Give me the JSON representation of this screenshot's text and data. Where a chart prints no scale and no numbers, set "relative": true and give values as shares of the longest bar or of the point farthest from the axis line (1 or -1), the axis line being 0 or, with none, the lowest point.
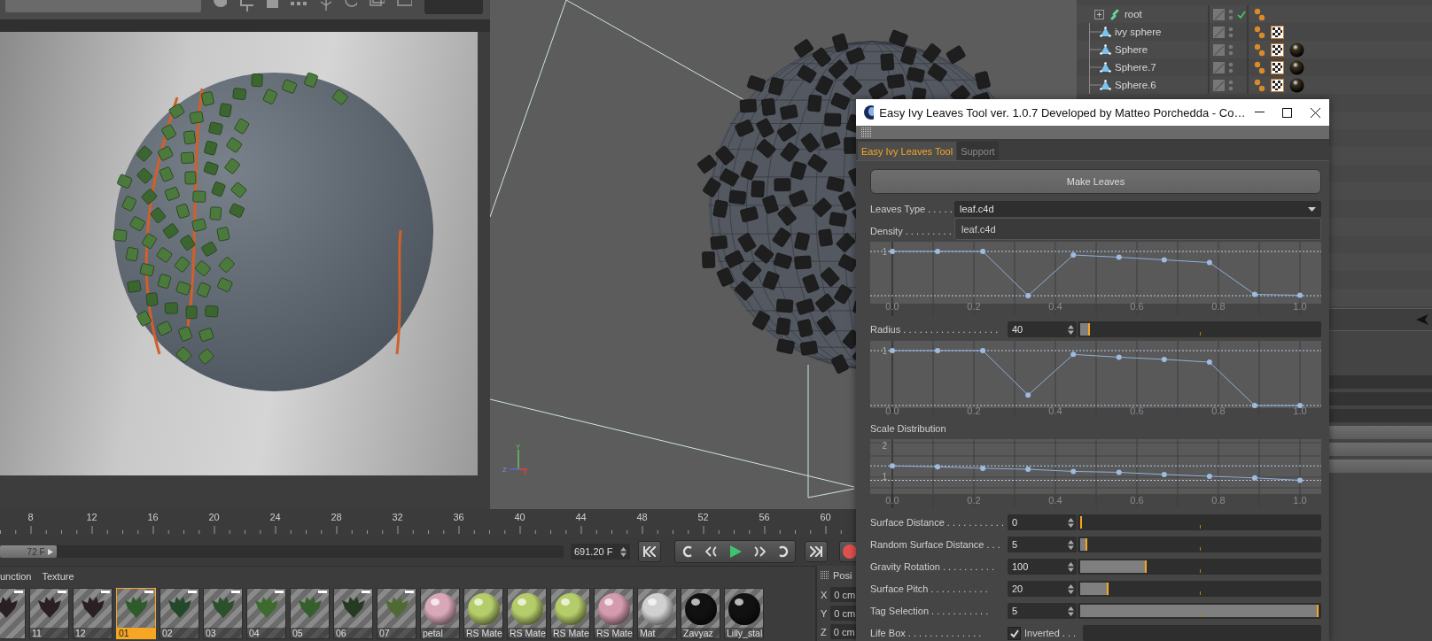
{
  "viewport": {
    "axis_labels": [
      "Y",
      "Z",
      "X"
    ]
  },
  "object_manager": {
    "rows": [
      {
        "name": "root",
        "kind": "null",
        "expandable": true,
        "checked": true,
        "texture_tag": false,
        "material_tag": false
      },
      {
        "name": "ivy sphere",
        "kind": "primitive",
        "expandable": false,
        "checked": false,
        "texture_tag": true,
        "material_tag": false
      },
      {
        "name": "Sphere",
        "kind": "primitive",
        "expandable": false,
        "checked": false,
        "texture_tag": true,
        "material_tag": true
      },
      {
        "name": "Sphere.7",
        "kind": "primitive",
        "expandable": false,
        "checked": false,
        "texture_tag": true,
        "material_tag": true
      },
      {
        "name": "Sphere.6",
        "kind": "primitive",
        "expandable": false,
        "checked": false,
        "texture_tag": true,
        "material_tag": true
      }
    ]
  },
  "timeline": {
    "ruler": [
      "8",
      "12",
      "16",
      "20",
      "24",
      "28",
      "32",
      "36",
      "40",
      "44",
      "48",
      "52",
      "56",
      "60"
    ],
    "handle": "72 F",
    "level": 0.1,
    "frame": "691.20 F"
  },
  "material_manager": {
    "menu": [
      "unction",
      "Texture"
    ],
    "materials": [
      {
        "kind": "leaf",
        "color": "#2a1f22",
        "selected": false
      },
      {
        "kind": "leaf",
        "label": "11",
        "color": "#2a1f22",
        "selected": false
      },
      {
        "kind": "leaf",
        "label": "12",
        "color": "#2a1f22",
        "selected": false
      },
      {
        "kind": "leaf",
        "label": "01",
        "color": "#2f5a2a",
        "selected": true
      },
      {
        "kind": "leaf",
        "label": "02",
        "color": "#24482a",
        "selected": false
      },
      {
        "kind": "leaf",
        "label": "03",
        "color": "#2c4f2c",
        "selected": false
      },
      {
        "kind": "leaf",
        "label": "04",
        "color": "#3d6a2e",
        "selected": false
      },
      {
        "kind": "leaf",
        "label": "05",
        "color": "#355f2c",
        "selected": false
      },
      {
        "kind": "leaf",
        "label": "06",
        "color": "#243b22",
        "selected": false
      },
      {
        "kind": "leaf",
        "label": "07",
        "color": "#4f6b33",
        "selected": false
      },
      {
        "kind": "ball",
        "label": "petal",
        "color": "#d9a8b8",
        "selected": false
      },
      {
        "kind": "ball",
        "label": "RS Mate",
        "color": "#b5cc6a",
        "selected": false
      },
      {
        "kind": "ball",
        "label": "RS Mate",
        "color": "#b5cc6a",
        "selected": false
      },
      {
        "kind": "ball",
        "label": "RS Mate",
        "color": "#b5cc6a",
        "selected": false
      },
      {
        "kind": "ball",
        "label": "RS Mate",
        "color": "#d49aae",
        "selected": false
      },
      {
        "kind": "ball",
        "label": "Mat",
        "color": "#d0d0d0",
        "selected": false
      },
      {
        "kind": "ball",
        "label": "Zavyaz",
        "color": "#111111",
        "selected": false
      },
      {
        "kind": "ball",
        "label": "Lilly_stal",
        "color": "#111111",
        "selected": false
      }
    ]
  },
  "coordinates": {
    "title": "Posi",
    "rows": [
      {
        "axis": "X",
        "value": "0 cm"
      },
      {
        "axis": "Y",
        "value": "0 cm"
      },
      {
        "axis": "Z",
        "value": "0 cm"
      }
    ]
  },
  "dialog": {
    "title": "Easy Ivy Leaves Tool ver. 1.0.7 Developed by Matteo Porchedda - Co…",
    "tabs": [
      {
        "label": "Easy Ivy Leaves Tool",
        "selected": true
      },
      {
        "label": "Support",
        "selected": false
      }
    ],
    "controls": [
      {
        "kind": "button",
        "label": "Make Leaves"
      },
      {
        "kind": "dropdown",
        "label": "Leaves Type . . . . .",
        "value": "leaf.c4d",
        "open_option": "leaf.c4d"
      },
      {
        "kind": "label",
        "label": "Density . . . . . . . . ."
      },
      {
        "kind": "chart",
        "chart_data": {
          "type": "line",
          "x": [
            0,
            0.111,
            0.222,
            0.333,
            0.444,
            0.556,
            0.667,
            0.778,
            0.889,
            1
          ],
          "series": [
            {
              "color": "#8fb0d8",
              "marker": "o",
              "values": [
                1,
                1,
                1,
                0,
                0.92,
                0.87,
                0.81,
                0.75,
                0.03,
                0.01
              ]
            }
          ],
          "relative": true,
          "grid": true,
          "ref_lines": [
            {
              "axis": "y",
              "value": 1
            },
            {
              "axis": "y",
              "value": 0
            }
          ],
          "annotations": [
            {
              "text": "1"
            }
          ],
          "xlim": [
            0,
            1
          ],
          "xticks": [
            {
              "value": 0,
              "label": "0.0"
            },
            {
              "value": 0.2,
              "label": "0.2"
            },
            {
              "value": 0.4,
              "label": "0.4"
            },
            {
              "value": 0.6,
              "label": "0.6"
            },
            {
              "value": 0.8,
              "label": "0.8"
            },
            {
              "value": 1,
              "label": "1.0"
            }
          ]
        }
      },
      {
        "kind": "slider",
        "label": "Radius . . . . . . . . . . . . . . . . . .",
        "value": "40",
        "level": 0.04
      },
      {
        "kind": "chart",
        "chart_data": {
          "type": "line",
          "x": [
            0,
            0.111,
            0.222,
            0.333,
            0.444,
            0.556,
            0.667,
            0.778,
            0.889,
            1
          ],
          "series": [
            {
              "color": "#8fb0d8",
              "marker": "o",
              "values": [
                1,
                1,
                1,
                0.19,
                0.93,
                0.88,
                0.84,
                0.79,
                0,
                0
              ]
            }
          ],
          "relative": true,
          "grid": true,
          "ref_lines": [
            {
              "axis": "y",
              "value": 1
            },
            {
              "axis": "y",
              "value": 0
            }
          ],
          "annotations": [
            {
              "text": "1"
            }
          ],
          "xlim": [
            0,
            1
          ],
          "xticks": [
            {
              "value": 0,
              "label": "0.0"
            },
            {
              "value": 0.2,
              "label": "0.2"
            },
            {
              "value": 0.4,
              "label": "0.4"
            },
            {
              "value": 0.6,
              "label": "0.6"
            },
            {
              "value": 0.8,
              "label": "0.8"
            },
            {
              "value": 1,
              "label": "1.0"
            }
          ]
        }
      },
      {
        "kind": "label",
        "label": "Scale Distribution"
      },
      {
        "kind": "chart",
        "chart_data": {
          "type": "line",
          "x": [
            0,
            0.111,
            0.222,
            0.333,
            0.444,
            0.556,
            0.667,
            0.778,
            0.889,
            1
          ],
          "series": [
            {
              "color": "#8fb0d8",
              "marker": "o",
              "values": [
                1.33,
                1.3,
                1.25,
                1.22,
                1.15,
                1.12,
                1.05,
                0.99,
                0.94,
                0.86
              ]
            }
          ],
          "grid": true,
          "ref_lines": [
            {
              "axis": "y",
              "value": 1.33
            },
            {
              "axis": "y",
              "value": 0.86
            }
          ],
          "xlim": [
            0,
            1
          ],
          "ylim": [
            0.5,
            2.2
          ],
          "xticks": [
            {
              "value": 0,
              "label": "0.0"
            },
            {
              "value": 0.2,
              "label": "0.2"
            },
            {
              "value": 0.4,
              "label": "0.4"
            },
            {
              "value": 0.6,
              "label": "0.6"
            },
            {
              "value": 0.8,
              "label": "0.8"
            },
            {
              "value": 1,
              "label": "1.0"
            }
          ],
          "yticks": [
            1,
            2
          ]
        }
      },
      {
        "kind": "slider",
        "label": "Surface Distance . . . . . . . . . . .",
        "value": "0",
        "level": 0
      },
      {
        "kind": "slider",
        "label": "Random Surface Distance . . .",
        "value": "5",
        "level": 0.03
      },
      {
        "kind": "slider",
        "label": "Gravity Rotation . . . . . . . . . .",
        "value": "100",
        "level": 0.28
      },
      {
        "kind": "slider",
        "label": "Surface Pitch . . . . . . . . . . .",
        "value": "20",
        "level": 0.12
      },
      {
        "kind": "slider",
        "label": "Tag Selection . . . . . . . . . . .",
        "value": "5",
        "level": 1
      },
      {
        "kind": "checkbox",
        "label": "Life Box . . . . . . . . . . . . . .",
        "checked": true,
        "option": "Inverted . . ."
      }
    ]
  }
}
